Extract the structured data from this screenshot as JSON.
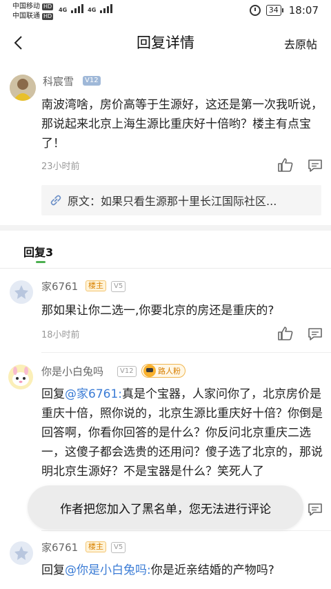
{
  "status_bar": {
    "carrier1": "中国移动",
    "carrier2": "中国联通",
    "hd": "HD",
    "net1": "4G",
    "net2": "4G",
    "battery": "34",
    "time": "18:07"
  },
  "nav": {
    "title": "回复详情",
    "right_action": "去原帖"
  },
  "main_comment": {
    "username": "科宸雪",
    "level": "V12",
    "text": "南波湾啥，房价高等于生源好，这还是第一次我听说，那说起来北京上海生源比重庆好十倍哟？楼主有点宝了！",
    "time": "23小时前",
    "quote_prefix": "原文：",
    "quote_text": "如果只看生源那十里长江国际社区..."
  },
  "replies_header": {
    "label": "回复3"
  },
  "replies": [
    {
      "username": "家6761",
      "owner_badge": "楼主",
      "level": "V5",
      "text": "那如果让你二选一,你要北京的房还是重庆的?",
      "time": "18小时前"
    },
    {
      "username": "你是小白兔吗",
      "level": "V12",
      "fan_badge": "路人粉",
      "reply_prefix": "回复",
      "mention": "@家6761:",
      "text": "真是个宝器，人家问你了，北京房价是重庆十倍，照你说的，北京生源比重庆好十倍？你倒是回答啊，你看你回答的是什么？你反问北京重庆二选一，这傻子都会选贵的还用问？傻子选了北京的，那说明北京生源好？不是宝器是什么？笑死人了"
    },
    {
      "username": "家6761",
      "owner_badge": "楼主",
      "level": "V5",
      "reply_prefix": "回复",
      "mention": "@你是小白兔吗:",
      "text": "你是近亲结婚的产物吗?"
    }
  ],
  "toast": {
    "message": "作者把您加入了黑名单，您无法进行评论"
  },
  "colors": {
    "accent_green": "#4caf50",
    "mention_blue": "#3a7bd5",
    "owner_orange": "#d98200"
  },
  "icons": [
    "back-arrow-icon",
    "alarm-icon",
    "thumbs-up-icon",
    "comment-icon",
    "link-icon"
  ]
}
